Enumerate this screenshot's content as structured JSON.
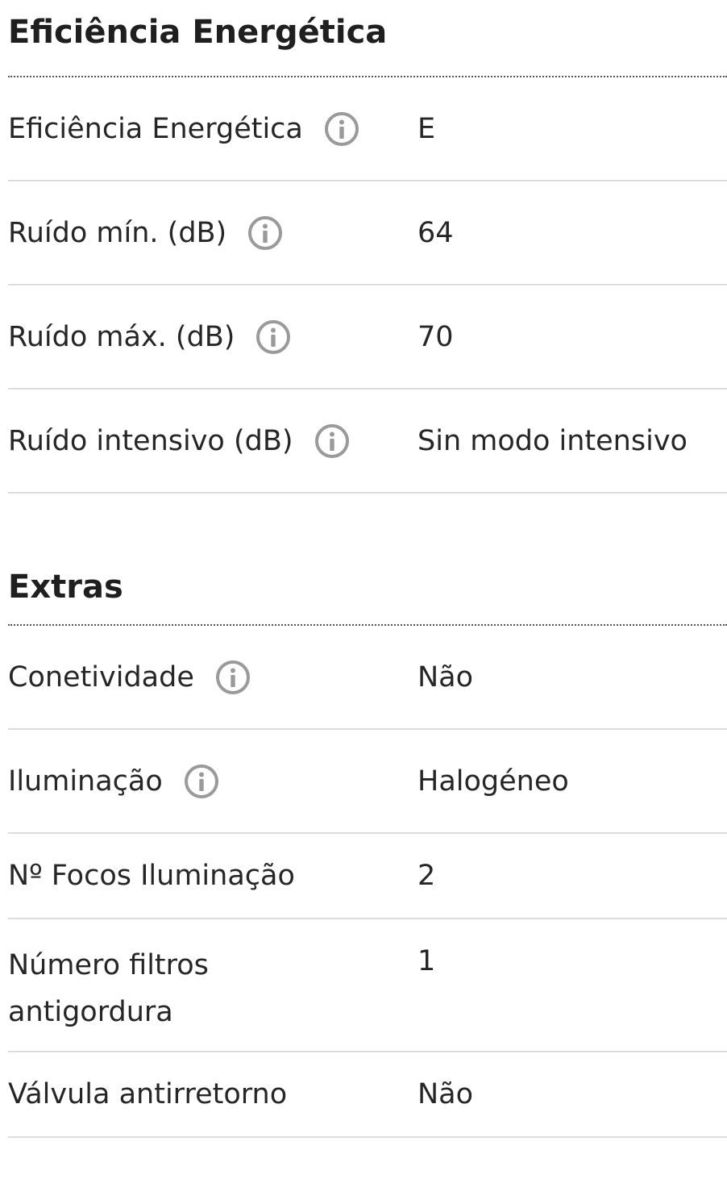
{
  "sections": [
    {
      "title": "Eficiência Energética",
      "rows": [
        {
          "label": "Eficiência Energética",
          "value": "E",
          "icon": "info-icon"
        },
        {
          "label": "Ruído mín. (dB)",
          "value": "64",
          "icon": "info-icon"
        },
        {
          "label": "Ruído máx. (dB)",
          "value": "70",
          "icon": "info-icon"
        },
        {
          "label": "Ruído intensivo (dB)",
          "value": "Sin modo intensivo",
          "icon": "info-icon"
        }
      ]
    },
    {
      "title": "Extras",
      "rows": [
        {
          "label": "Conetividade",
          "value": "Não",
          "icon": "info-icon"
        },
        {
          "label": "Iluminação",
          "value": "Halogéneo",
          "icon": "info-icon"
        },
        {
          "label": "Nº Focos Iluminação",
          "value": "2"
        },
        {
          "label": "Número filtros antigordura",
          "value": "1"
        },
        {
          "label": "Válvula antirretorno",
          "value": "Não"
        }
      ]
    }
  ],
  "colors": {
    "text": "#262626",
    "icon": "#9a9a9a",
    "divider": "#dcdcdc",
    "title_divider": "#555555"
  }
}
